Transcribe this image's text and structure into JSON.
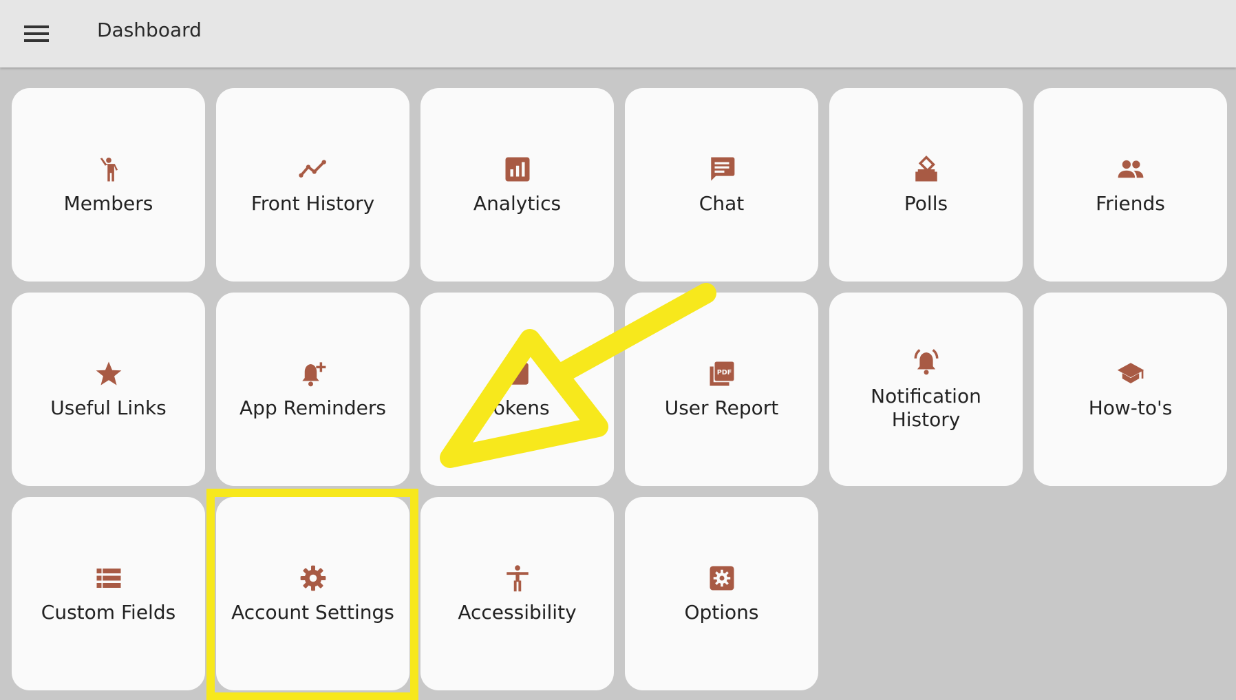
{
  "appbar": {
    "title": "Dashboard",
    "menu_icon": "hamburger-menu-icon"
  },
  "tiles": [
    {
      "label": "Members",
      "icon": "person-waving-icon"
    },
    {
      "label": "Front History",
      "icon": "trend-line-icon"
    },
    {
      "label": "Analytics",
      "icon": "bar-chart-icon"
    },
    {
      "label": "Chat",
      "icon": "chat-bubble-icon"
    },
    {
      "label": "Polls",
      "icon": "ballot-box-icon"
    },
    {
      "label": "Friends",
      "icon": "people-icon"
    },
    {
      "label": "Useful Links",
      "icon": "star-icon"
    },
    {
      "label": "App Reminders",
      "icon": "bell-plus-icon"
    },
    {
      "label": "Tokens",
      "icon": "token-icon"
    },
    {
      "label": "User Report",
      "icon": "pdf-icon"
    },
    {
      "label": "Notification History",
      "icon": "bell-ringing-icon"
    },
    {
      "label": "How-to's",
      "icon": "graduation-cap-icon"
    },
    {
      "label": "Custom Fields",
      "icon": "list-icon"
    },
    {
      "label": "Account Settings",
      "icon": "gear-icon"
    },
    {
      "label": "Accessibility",
      "icon": "accessibility-icon"
    },
    {
      "label": "Options",
      "icon": "settings-box-icon"
    }
  ],
  "annotations": {
    "highlight_color": "#f7e81c",
    "highlighted_tile": "Account Settings",
    "arrow_color": "#f7e81c"
  },
  "colors": {
    "icon": "#a85a44",
    "appbar_bg": "#e6e6e6",
    "page_bg": "#c8c8c8",
    "tile_bg": "#fafafa"
  }
}
